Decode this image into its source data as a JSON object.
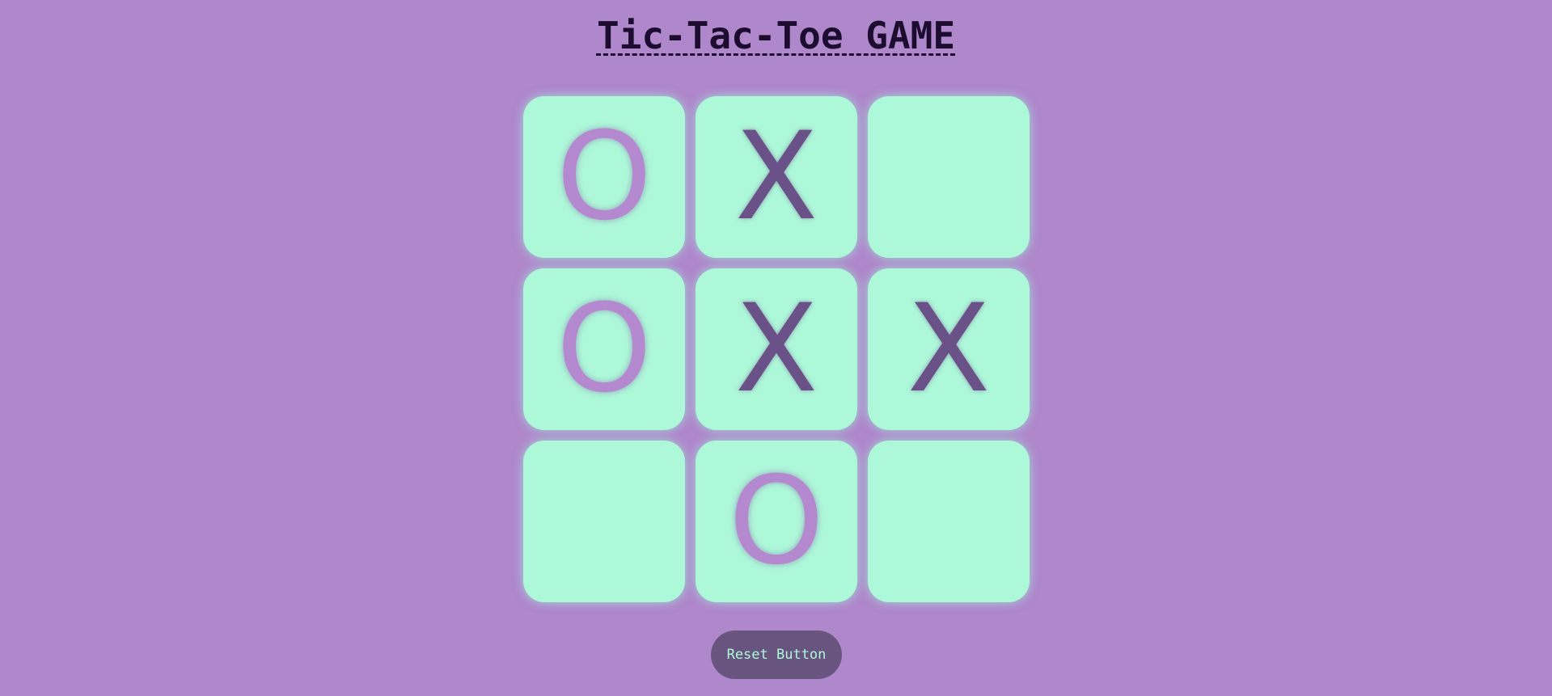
{
  "title": "Tic-Tac-Toe GAME",
  "board": {
    "cells": [
      "O",
      "X",
      "",
      "O",
      "X",
      "X",
      "",
      "O",
      ""
    ]
  },
  "reset_label": "Reset Button",
  "colors": {
    "background": "#af87cb",
    "cell": "#aef8da",
    "x_mark": "#6a5289",
    "o_mark": "#b589cf",
    "button": "#67547f",
    "button_text": "#aef8da",
    "title": "#1c0c30"
  }
}
